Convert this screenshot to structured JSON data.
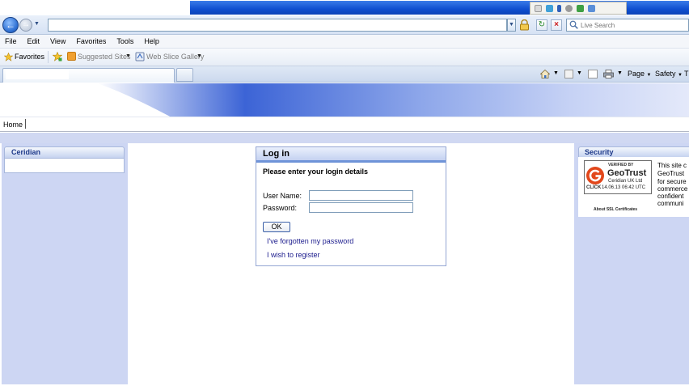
{
  "browser": {
    "search": {
      "placeholder": "Live Search"
    },
    "menu": [
      "File",
      "Edit",
      "View",
      "Favorites",
      "Tools",
      "Help"
    ],
    "favorites_bar": {
      "favorites_label": "Favorites",
      "suggested_sites_label": "Suggested Sites",
      "web_slice_gallery_label": "Web Slice Gallery"
    },
    "command_bar": {
      "page_label": "Page",
      "safety_label": "Safety",
      "tools_label_truncated": "T"
    }
  },
  "page": {
    "nav": {
      "home_label": "Home"
    },
    "left_panel": {
      "title": "Ceridian"
    },
    "login": {
      "title": "Log in",
      "prompt": "Please enter your login details",
      "username_label": "User Name:",
      "password_label": "Password:",
      "ok_label": "OK",
      "forgot_link": "I've forgotten my password",
      "register_link": "I wish to register"
    },
    "security": {
      "title": "Security",
      "seal": {
        "verified_by": "VERIFIED BY",
        "brand": "GeoTrust",
        "company": "Ceridian UK Ltd",
        "click_label": "CLICK",
        "date": "14.06.13 06:42 UTC"
      },
      "about_ssl": "About SSL Certificates",
      "text_lines": [
        "This site c",
        "GeoTrust",
        "for secure",
        "commerce",
        "confident",
        "communi"
      ]
    }
  },
  "colors": {
    "title_blue": "#0f4fd0",
    "panel_lavender": "#cdd6f3",
    "heading_blue": "#1e3a8a",
    "link_blue": "#1a1a8c",
    "login_rule": "#6e93d8"
  }
}
